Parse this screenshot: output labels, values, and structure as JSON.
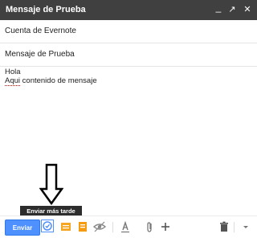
{
  "window": {
    "title": "Mensaje de Prueba",
    "controls": {
      "minimize": "_",
      "popout": "↗",
      "close": "✕"
    }
  },
  "fields": {
    "to": "Cuenta de Evernote",
    "subject": "Mensaje de Prueba"
  },
  "message": {
    "line1": "Hola",
    "line2_spell": "Aqui",
    "line2_rest": " contenido de mensaje"
  },
  "tooltip": {
    "schedule": "Enviar más tarde"
  },
  "toolbar": {
    "send_label": "Enviar",
    "icons": [
      "schedule-icon",
      "template-icon",
      "note-icon",
      "eye-icon",
      "format-text-icon",
      "attach-icon",
      "more-insert-icon",
      "trash-icon",
      "more-options-icon"
    ],
    "accent": "#4d90fe"
  }
}
